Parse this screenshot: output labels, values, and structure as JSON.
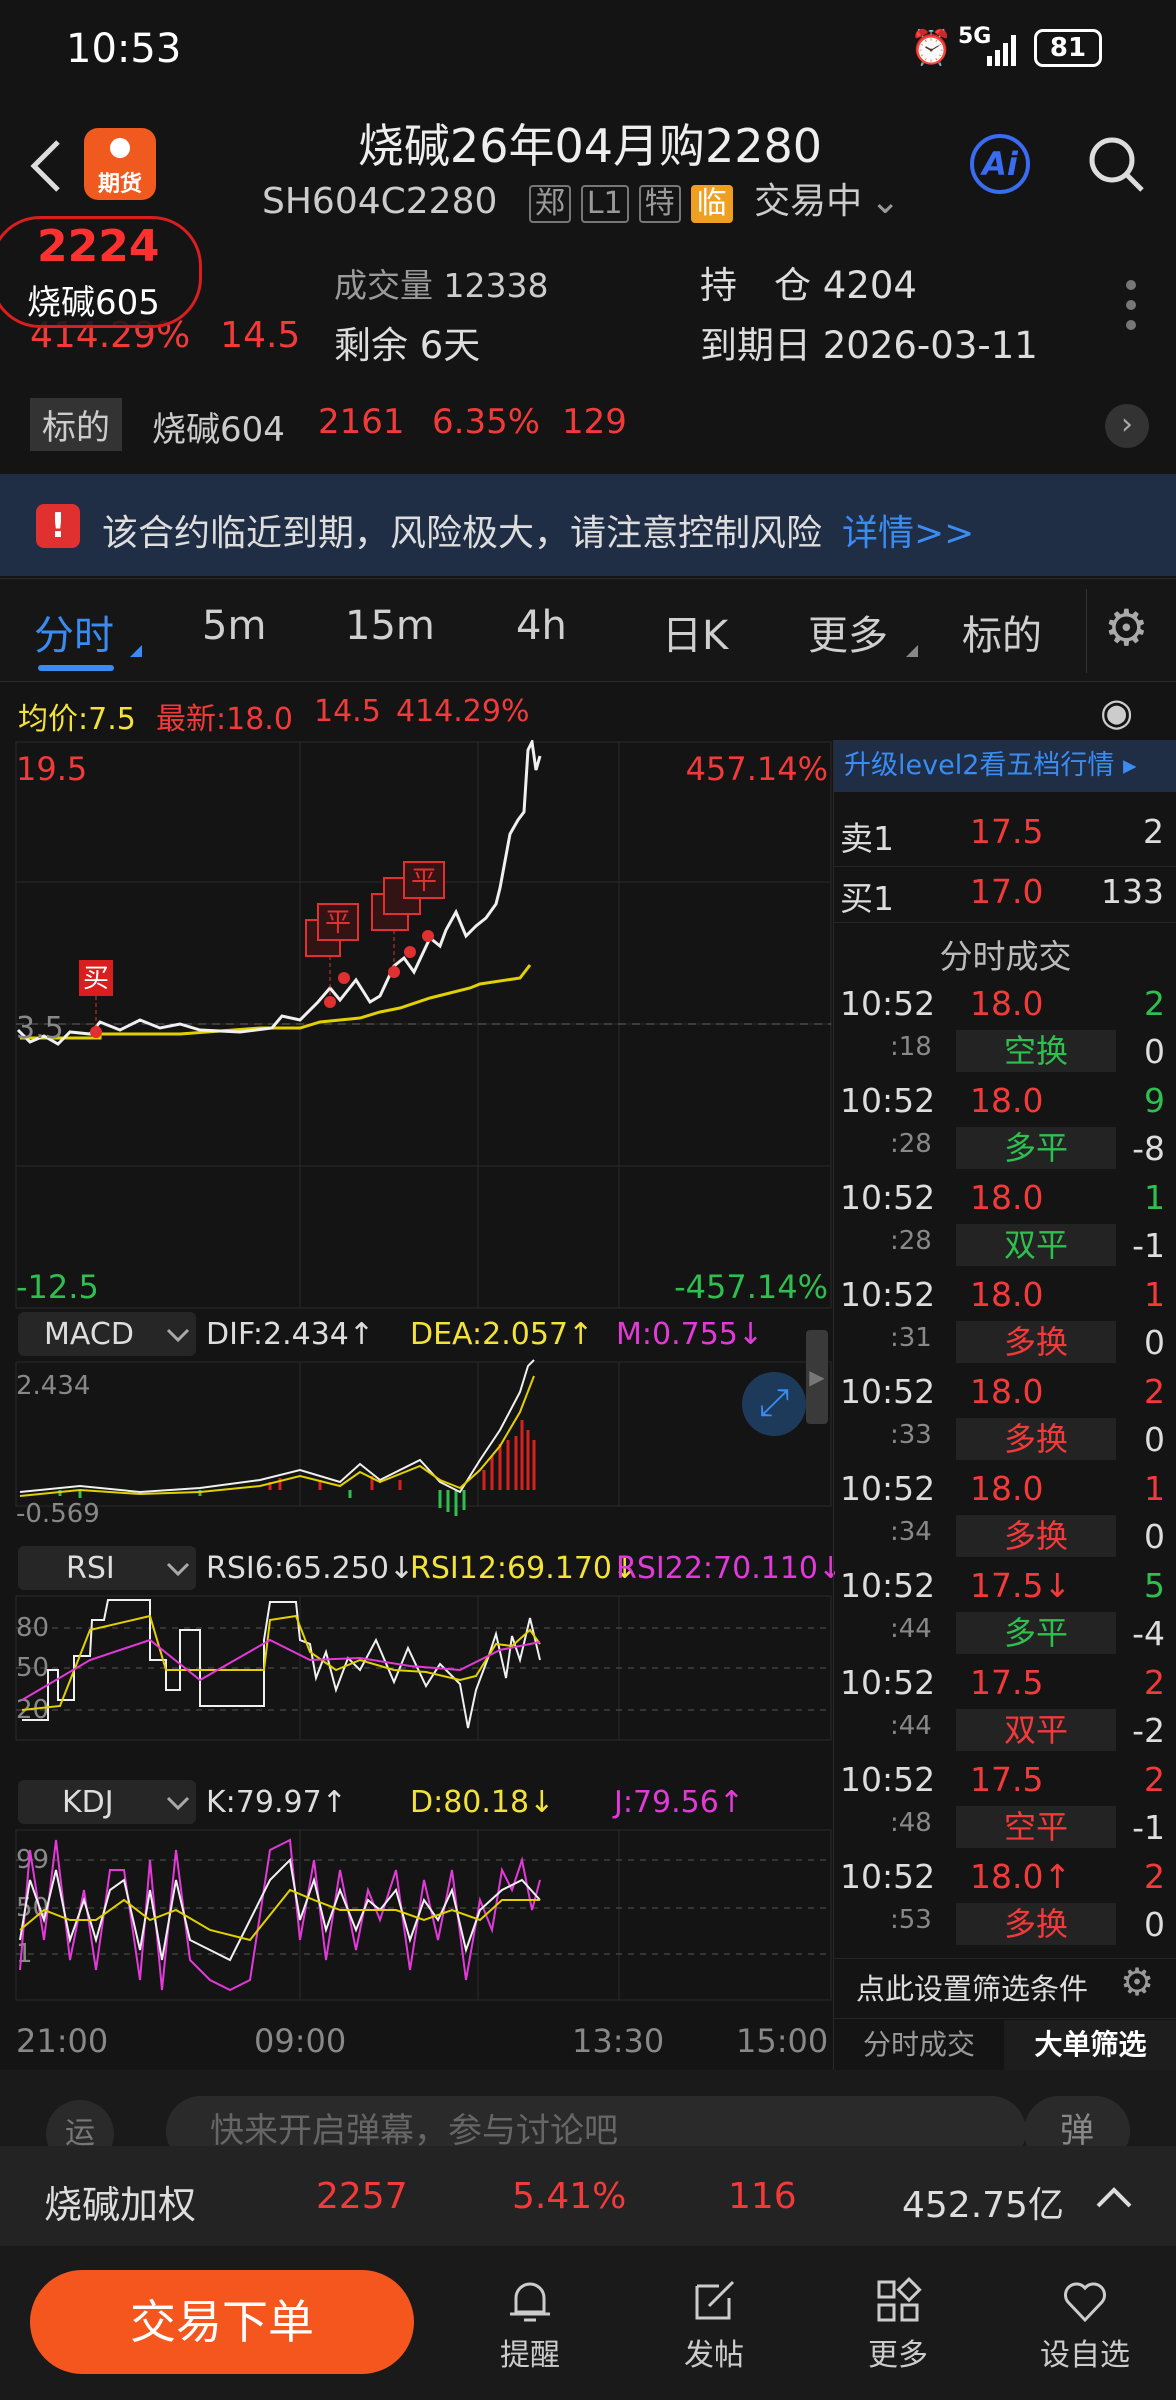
{
  "status": {
    "time": "10:53",
    "net": "5G",
    "battery": "81"
  },
  "header": {
    "title": "烧碱26年04月购2280",
    "code": "SH604C2280",
    "tags": [
      "郑",
      "L1",
      "特",
      "临"
    ],
    "state": "交易中",
    "ai": "Ai"
  },
  "floating": {
    "price": "2224",
    "name": "烧碱605"
  },
  "stats": {
    "change_pct": "414.29%",
    "change": "14.5",
    "vol_label": "成交量",
    "vol": "12338",
    "oi_label": "持　仓",
    "oi": "4204",
    "remain_label": "剩余",
    "remain": "6天",
    "expiry_label": "到期日",
    "expiry": "2026-03-11"
  },
  "underlying": {
    "label": "标的",
    "name": "烧碱604",
    "price": "2161",
    "pct": "6.35%",
    "chg": "129"
  },
  "warning": {
    "text": "该合约临近到期，风险极大，请注意控制风险",
    "link": "详情>>"
  },
  "tabs": [
    "分时",
    "5m",
    "15m",
    "4h",
    "日K",
    "更多",
    "标的"
  ],
  "info": {
    "avg": "均价:7.5",
    "latest": "最新:18.0",
    "chg": "14.5",
    "pct": "414.29%"
  },
  "chart": {
    "max": "19.5",
    "max_pct": "457.14%",
    "min": "-12.5",
    "min_pct": "-457.14%",
    "mid": "3.5",
    "buy": "买",
    "close": "平",
    "open": "买",
    "x_labels": [
      "21:00",
      "09:00",
      "13:30",
      "15:00"
    ]
  },
  "macd": {
    "name": "MACD",
    "dif": "DIF:2.434↑",
    "dea": "DEA:2.057↑",
    "m": "M:0.755↓",
    "top": "2.434",
    "bottom": "-0.569"
  },
  "rsi": {
    "name": "RSI",
    "r6": "RSI6:65.250↓",
    "r12": "RSI12:69.170↓",
    "r22": "RSI22:70.110↓",
    "ticks": [
      "80",
      "50",
      "20"
    ]
  },
  "kdj": {
    "name": "KDJ",
    "k": "K:79.97↑",
    "d": "D:80.18↓",
    "j": "J:79.56↑",
    "ticks": [
      "99",
      "50",
      "1"
    ]
  },
  "side": {
    "level2": "升级level2看五档行情 ▸",
    "sell_label": "卖1",
    "sell_price": "17.5",
    "sell_vol": "2",
    "buy_label": "买1",
    "buy_price": "17.0",
    "buy_vol": "133",
    "trades_title": "分时成交",
    "trades": [
      {
        "t": "10:52",
        "s": ":18",
        "p": "18.0",
        "v": "2",
        "type": "空换",
        "n": "0",
        "tc": "grn",
        "vc": "grn"
      },
      {
        "t": "10:52",
        "s": ":28",
        "p": "18.0",
        "v": "9",
        "type": "多平",
        "n": "-8",
        "tc": "grn",
        "vc": "grn"
      },
      {
        "t": "10:52",
        "s": ":28",
        "p": "18.0",
        "v": "1",
        "type": "双平",
        "n": "-1",
        "tc": "grn",
        "vc": "grn"
      },
      {
        "t": "10:52",
        "s": ":31",
        "p": "18.0",
        "v": "1",
        "type": "多换",
        "n": "0",
        "tc": "red",
        "vc": "red"
      },
      {
        "t": "10:52",
        "s": ":33",
        "p": "18.0",
        "v": "2",
        "type": "多换",
        "n": "0",
        "tc": "red",
        "vc": "red"
      },
      {
        "t": "10:52",
        "s": ":34",
        "p": "18.0",
        "v": "1",
        "type": "多换",
        "n": "0",
        "tc": "red",
        "vc": "red"
      },
      {
        "t": "10:52",
        "s": ":44",
        "p": "17.5↓",
        "v": "5",
        "type": "多平",
        "n": "-4",
        "tc": "grn",
        "vc": "grn"
      },
      {
        "t": "10:52",
        "s": ":44",
        "p": "17.5",
        "v": "2",
        "type": "双平",
        "n": "-2",
        "tc": "red",
        "vc": "red"
      },
      {
        "t": "10:52",
        "s": ":48",
        "p": "17.5",
        "v": "2",
        "type": "空平",
        "n": "-1",
        "tc": "red",
        "vc": "red"
      },
      {
        "t": "10:52",
        "s": ":53",
        "p": "18.0↑",
        "v": "2",
        "type": "多换",
        "n": "0",
        "tc": "red",
        "vc": "red"
      }
    ],
    "filter": "点此设置筛选条件",
    "tab1": "分时成交",
    "tab2": "大单筛选"
  },
  "comment": {
    "placeholder": "快来开启弹幕，参与讨论吧",
    "danmu": "弹"
  },
  "ticker": {
    "name": "烧碱加权",
    "price": "2257",
    "pct": "5.41%",
    "chg": "116",
    "amount": "452.75亿"
  },
  "bottom": {
    "trade": "交易下单",
    "items": [
      "提醒",
      "发帖",
      "更多",
      "设自选"
    ]
  }
}
